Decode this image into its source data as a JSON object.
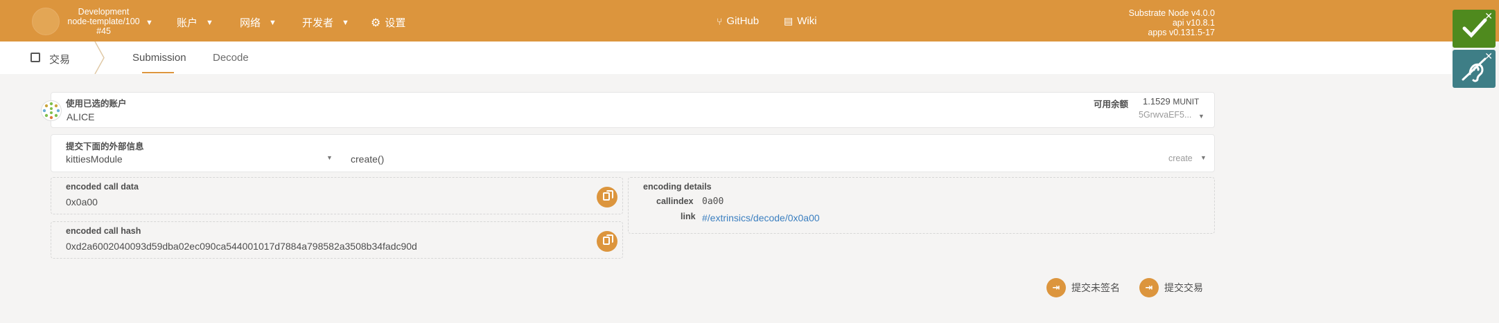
{
  "topbar": {
    "chain_name": "Development",
    "chain_runtime": "node-template/100",
    "chain_block": "#45",
    "menu": [
      {
        "label": "账户"
      },
      {
        "label": "网络"
      },
      {
        "label": "开发者"
      }
    ],
    "settings_label": "设置",
    "github_label": "GitHub",
    "wiki_label": "Wiki",
    "version": {
      "node": "Substrate Node v4.0.0",
      "api": "api v10.8.1",
      "apps": "apps v0.131.5-17"
    },
    "accent_color": "#dc953d"
  },
  "notifications": [
    {
      "icon": "check-icon",
      "color": "#4f8a1e"
    },
    {
      "icon": "deaf-icon",
      "color": "#3e7e86"
    }
  ],
  "tabbar": {
    "section": "交易",
    "tabs": [
      {
        "label": "Submission",
        "active": true
      },
      {
        "label": "Decode",
        "active": false
      }
    ]
  },
  "account": {
    "label": "使用已选的账户",
    "name": "ALICE",
    "balance_label": "可用余额",
    "balance_value": "1.1529",
    "balance_unit": "MUNIT",
    "address": "5GrwvaEF5..."
  },
  "extrinsic": {
    "label": "提交下面的外部信息",
    "module": "kittiesModule",
    "call": "create()",
    "call_hint": "create"
  },
  "encoded": {
    "call_data_label": "encoded call data",
    "call_data": "0x0a00",
    "call_hash_label": "encoded call hash",
    "call_hash": "0xd2a6002040093d59dba02ec090ca544001017d7884a798582a3508b34fadc90d"
  },
  "details": {
    "label": "encoding details",
    "callindex_label": "callindex",
    "callindex": "0a00",
    "link_label": "link",
    "link": "#/extrinsics/decode/0x0a00"
  },
  "actions": {
    "unsigned_label": "提交未签名",
    "submit_label": "提交交易"
  }
}
